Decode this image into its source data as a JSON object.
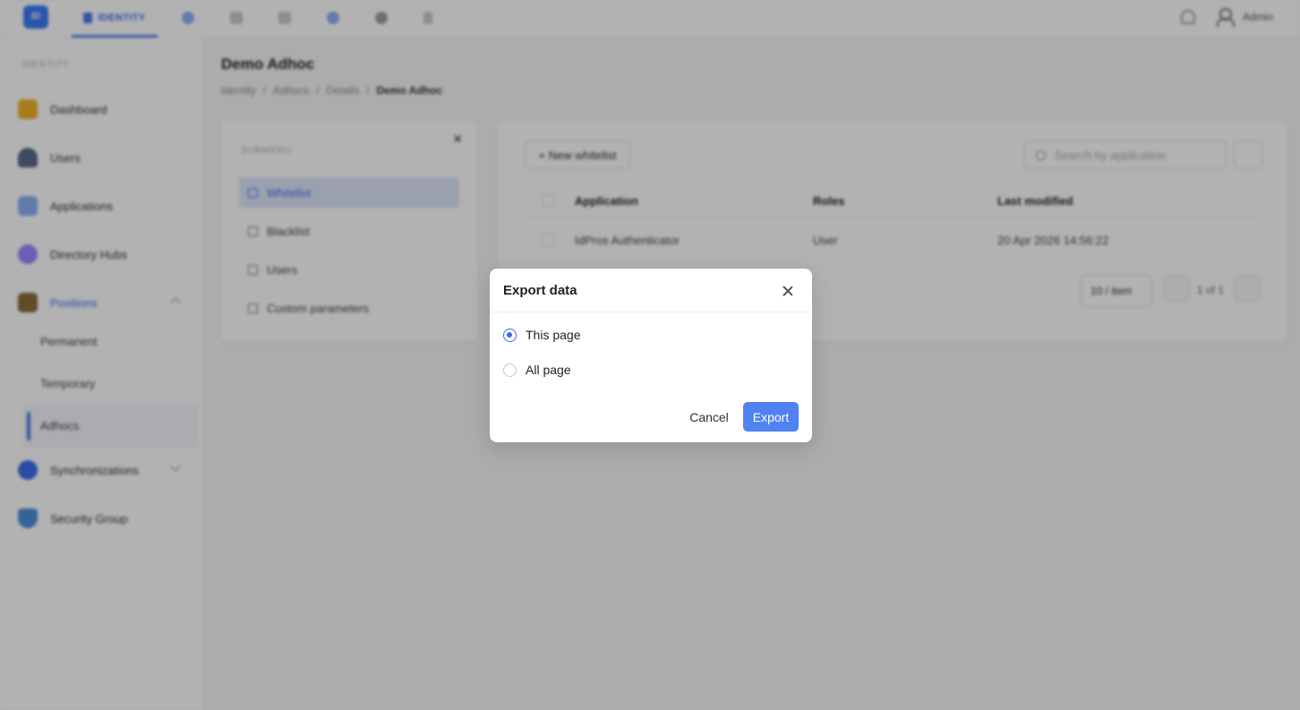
{
  "topbar": {
    "logo_text": "ID",
    "active_tab": "IDENTITY",
    "user_name": "Admin"
  },
  "sidebar": {
    "section_label": "IDENTITY",
    "items": [
      {
        "label": "Dashboard",
        "icon": "dashboard-icon",
        "color": "#f0b429"
      },
      {
        "label": "Users",
        "icon": "users-icon",
        "color": "#5a6b8c"
      },
      {
        "label": "Applications",
        "icon": "applications-icon",
        "color": "#4a7af0"
      },
      {
        "label": "Directory Hubs",
        "icon": "directory-hubs-icon",
        "color": "#7b61ff"
      },
      {
        "label": "Positions",
        "icon": "positions-icon",
        "color": "#8a6d3b"
      },
      {
        "label": "Synchronizations",
        "icon": "synchronizations-icon",
        "color": "#3b6df0"
      },
      {
        "label": "Security Group",
        "icon": "security-group-icon",
        "color": "#4a90d9"
      }
    ],
    "sub_items": [
      "Permanent",
      "Temporary",
      "Adhocs"
    ]
  },
  "page": {
    "title": "Demo Adhoc",
    "breadcrumbs": [
      "Identity",
      "Adhocs",
      "Details",
      "Demo Adhoc"
    ]
  },
  "left_panel": {
    "caption": "SUBMENU",
    "items": [
      "Whitelist",
      "Blacklist",
      "Users",
      "Custom parameters"
    ]
  },
  "main": {
    "new_button": "+ New whitelist",
    "search_placeholder": "Search by application",
    "columns": [
      "Application",
      "Roles",
      "Last modified"
    ],
    "rows": [
      {
        "application": "IdPros Authenticator",
        "roles": "User",
        "last_modified": "20 Apr 2026 14:56:22"
      }
    ],
    "page_size": "10 / item",
    "page_info": "1 of 1"
  },
  "modal": {
    "title": "Export data",
    "options": [
      {
        "label": "This page",
        "checked": true
      },
      {
        "label": "All page",
        "checked": false
      }
    ],
    "cancel_label": "Cancel",
    "export_label": "Export",
    "accent": "#5082f2"
  }
}
